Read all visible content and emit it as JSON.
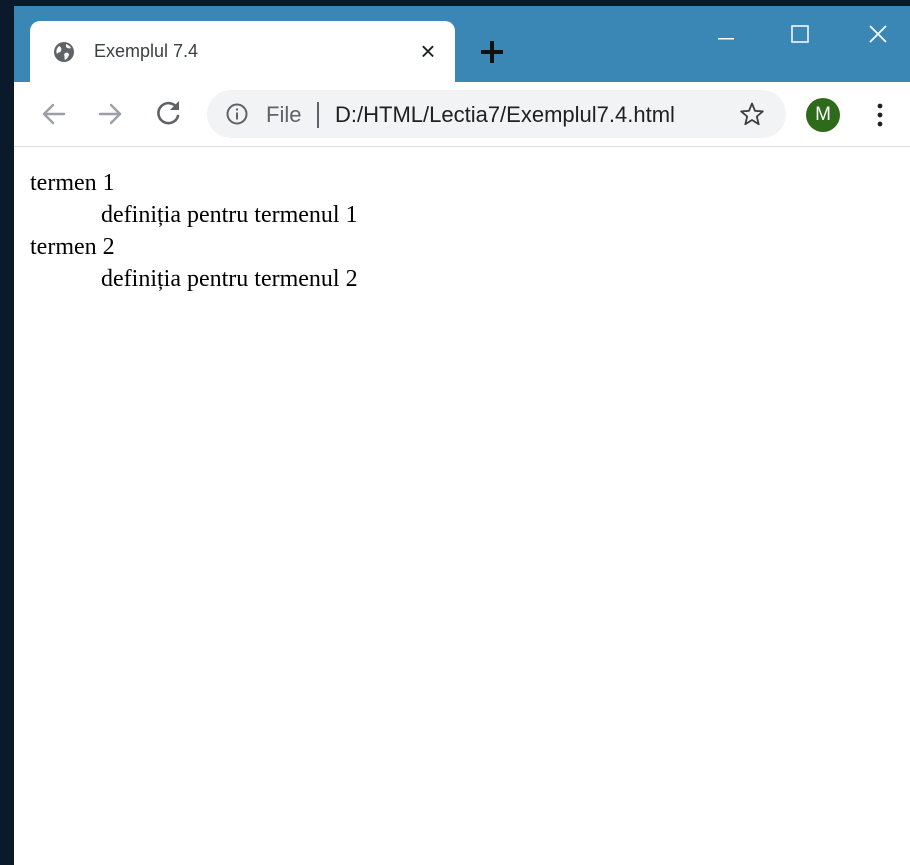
{
  "tab": {
    "title": "Exemplul 7.4",
    "favicon": "globe-icon",
    "close_glyph": "×"
  },
  "new_tab": {
    "icon": "plus-icon"
  },
  "window_controls": {
    "minimize": "minimize-icon",
    "maximize": "maximize-icon",
    "close": "close-icon"
  },
  "toolbar": {
    "back": "arrow-left-icon",
    "forward": "arrow-right-icon",
    "reload": "reload-icon"
  },
  "omnibox": {
    "info_icon": "info-icon",
    "scheme_label": "File",
    "url": "D:/HTML/Lectia7/Exemplul7.4.html",
    "bookmark_icon": "star-icon"
  },
  "profile": {
    "initial": "M",
    "color": "#2d6a19"
  },
  "menu": {
    "icon": "kebab-menu-icon"
  },
  "colors": {
    "titlebar": "#3a86b4",
    "page_background": "#ffffff",
    "desktop": "#0b1a2b"
  },
  "definition_list": [
    {
      "term": "termen 1",
      "definition": "definiția pentru termenul 1"
    },
    {
      "term": "termen 2",
      "definition": "definiția pentru termenul 2"
    }
  ]
}
